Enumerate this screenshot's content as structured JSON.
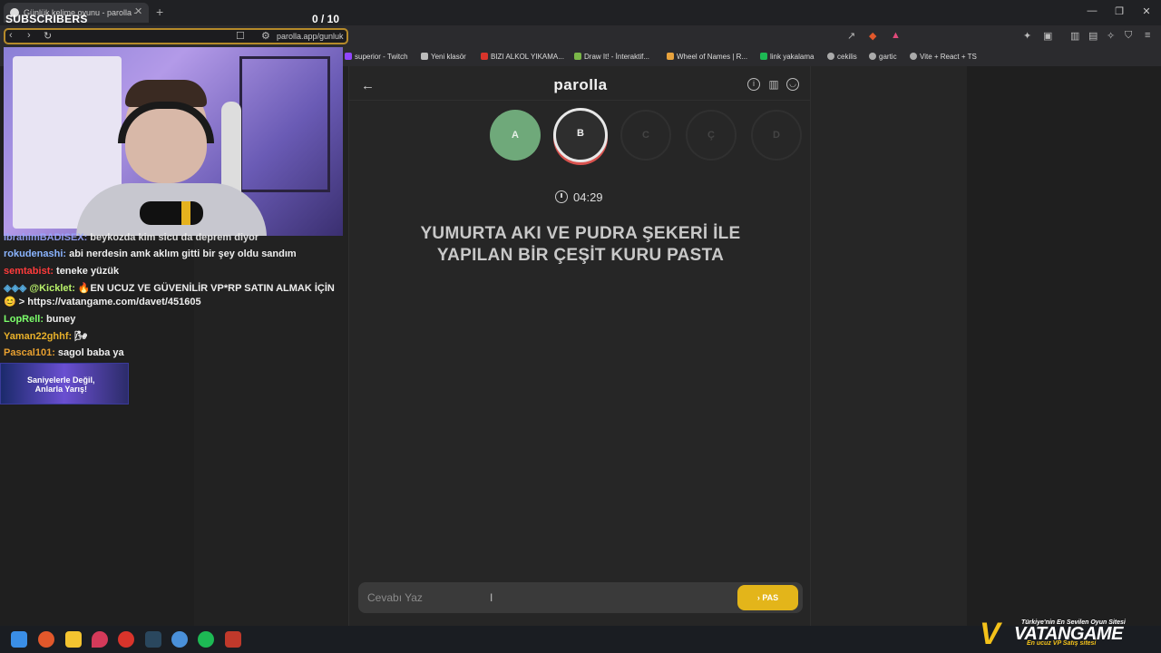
{
  "browser": {
    "tab_title": "Günlük kelime oyunu - parolla -",
    "url": "parolla.app/gunluk",
    "bookmarks": [
      {
        "label": "superior - Twitch",
        "color": "#9146ff"
      },
      {
        "label": "Yeni klasör",
        "color": "#bbbbbb"
      },
      {
        "label": "BIZI ALKOL YIKAMA...",
        "color": "#d9342b"
      },
      {
        "label": "Draw It! - İnteraktif...",
        "color": "#7ab648"
      },
      {
        "label": "Wheel of Names | R...",
        "color": "#e8a33d"
      },
      {
        "label": "link yakalama",
        "color": "#1db954"
      },
      {
        "label": "cekilis",
        "color": "#aaaaaa"
      },
      {
        "label": "gartic",
        "color": "#aaaaaa"
      },
      {
        "label": "Vite + React + TS",
        "color": "#aaaaaa"
      }
    ]
  },
  "stream": {
    "subscribers_label": "SUBSCRIBERS",
    "subscribers_count": "0 / 10"
  },
  "chat": [
    {
      "user": "IbrahimBADISEX:",
      "user_color": "#9aa7ff",
      "text": "beykozda kim sicu da deprem diyor"
    },
    {
      "user": "rokudenashi:",
      "user_color": "#8ab4ff",
      "text": "abi nerdesin amk aklım gitti bir şey oldu sandım"
    },
    {
      "user": "semtabist:",
      "user_color": "#ff3b3b",
      "text": "teneke yüzük"
    },
    {
      "user": "@Kicklet:",
      "user_color": "#b9f26a",
      "text": "🔥EN UCUZ VE GÜVENİLİR VP*RP SATIN ALMAK İÇİN"
    },
    {
      "user": "",
      "user_color": "#ffffff",
      "text": "😊 > https://vatangame.com/davet/451605"
    },
    {
      "user": "LopRell:",
      "user_color": "#7cff6b",
      "text": "buney"
    },
    {
      "user": "Yaman22ghhf:",
      "user_color": "#e8b02a",
      "text": "🌬"
    },
    {
      "user": "Pascal101:",
      "user_color": "#e8a030",
      "text": "sagol baba ya"
    }
  ],
  "promo": {
    "line1": "Saniyelerle Değil,",
    "line2": "Anlarla Yarış!"
  },
  "game": {
    "logo": "parolla",
    "letters": [
      {
        "char": "A",
        "state": "done"
      },
      {
        "char": "B",
        "state": "active"
      },
      {
        "char": "C",
        "state": "todo"
      },
      {
        "char": "Ç",
        "state": "todo"
      },
      {
        "char": "D",
        "state": "todo"
      }
    ],
    "timer": "04:29",
    "clue_line1": "YUMURTA AKI VE PUDRA ŞEKERİ İLE",
    "clue_line2": "YAPILAN BİR ÇEŞİT KURU PASTA",
    "answer_placeholder": "Cevabı Yaz",
    "pass_label": "› PAS"
  },
  "sponsor": {
    "tagline": "Türkiye'nin En Sevilen Oyun Sitesi",
    "name": "VATANGAME",
    "subline": "En ucuz VP Satış sitesi"
  }
}
